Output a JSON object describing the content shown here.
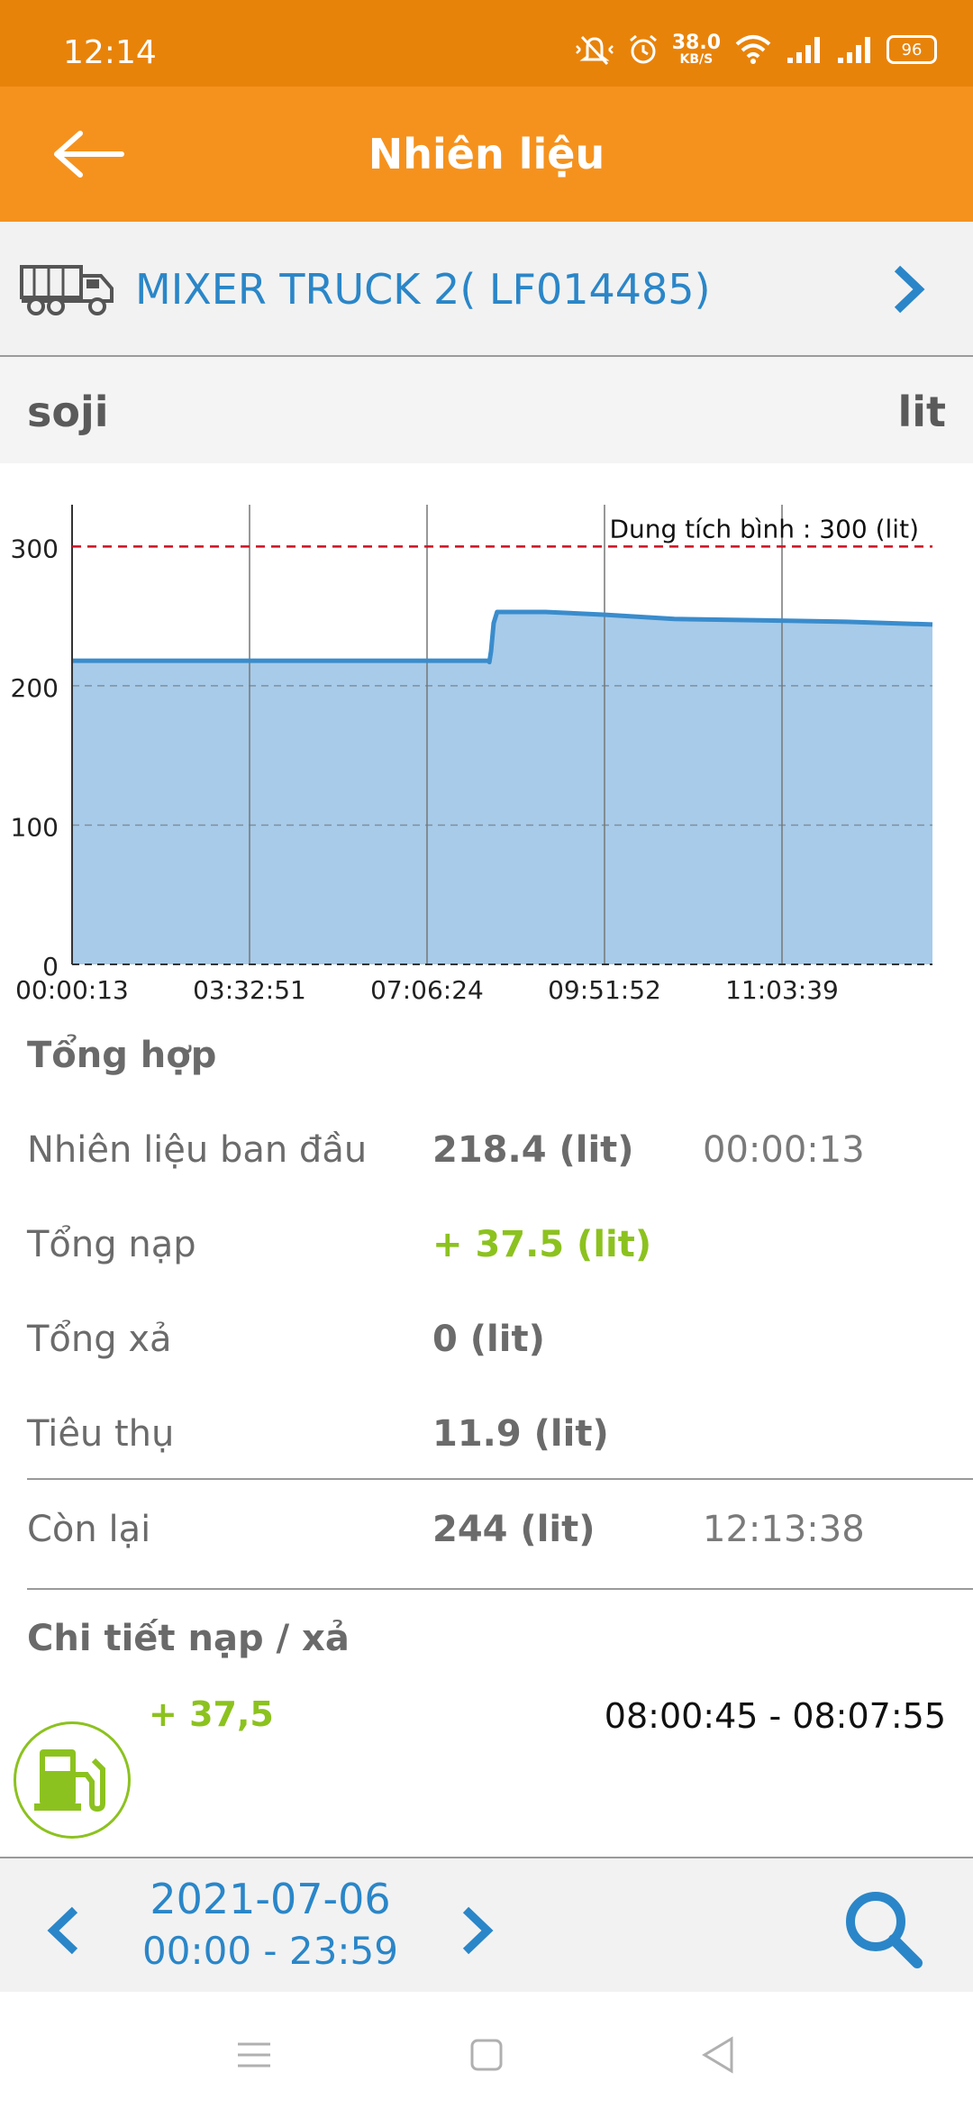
{
  "status": {
    "time": "12:14",
    "net_speed": "38.0",
    "net_unit": "KB/S",
    "battery": "96"
  },
  "header": {
    "title": "Nhiên liệu",
    "icons": {
      "back": "arrow-left-icon"
    }
  },
  "vehicle": {
    "name": "MIXER TRUCK 2( LF014485)",
    "icon": "truck-icon",
    "accent": "#2a86c8"
  },
  "sensor": {
    "name": "soji",
    "unit": "lit"
  },
  "chart_data": {
    "type": "area",
    "x_ticks": [
      "00:00:13",
      "03:32:51",
      "07:06:24",
      "09:51:52",
      "11:03:39"
    ],
    "y_ticks": [
      "0",
      "100",
      "200",
      "300"
    ],
    "ylim": [
      0,
      330
    ],
    "points": [
      {
        "t": 0.0,
        "v": 218
      },
      {
        "t": 0.485,
        "v": 218
      },
      {
        "t": 0.485,
        "v": 217
      },
      {
        "t": 0.485,
        "v": 217
      },
      {
        "t": 0.487,
        "v": 225
      },
      {
        "t": 0.49,
        "v": 245
      },
      {
        "t": 0.494,
        "v": 253
      },
      {
        "t": 0.55,
        "v": 253
      },
      {
        "t": 0.62,
        "v": 251
      },
      {
        "t": 0.7,
        "v": 248
      },
      {
        "t": 0.8,
        "v": 247
      },
      {
        "t": 0.9,
        "v": 246
      },
      {
        "t": 1.0,
        "v": 244
      }
    ],
    "capacity_value": 300,
    "capacity_label": "Dung tích bình : 300 (lit)",
    "line_color": "#3a8ccc",
    "fill_color": "#a7cbe9",
    "capacity_color": "#cc1122"
  },
  "summary": {
    "title": "Tổng hợp",
    "rows": [
      {
        "label": "Nhiên liệu ban đầu",
        "value": "218.4 (lit)",
        "time": "00:00:13"
      },
      {
        "label": "Tổng nạp",
        "value": "+ 37.5 (lit)",
        "time": ""
      },
      {
        "label": "Tổng xả",
        "value": "0 (lit)",
        "time": ""
      },
      {
        "label": "Tiêu thụ",
        "value": "11.9 (lit)",
        "time": ""
      },
      {
        "label": "Còn lại",
        "value": "244 (lit)",
        "time": "12:13:38"
      }
    ],
    "positive_color": "#8cc21f"
  },
  "details": {
    "title": "Chi tiết nạp / xả",
    "items": [
      {
        "amount": "+ 37,5",
        "range": "08:00:45 - 08:07:55",
        "icon": "fuel-pump-icon"
      }
    ]
  },
  "date_nav": {
    "date": "2021-07-06",
    "range": "00:00 - 23:59",
    "icons": {
      "prev": "chevron-left-icon",
      "next": "chevron-right-icon",
      "search": "search-icon"
    }
  },
  "system_nav": {
    "icons": {
      "menu": "menu-icon",
      "home": "home-icon",
      "back": "back-triangle-icon"
    }
  }
}
